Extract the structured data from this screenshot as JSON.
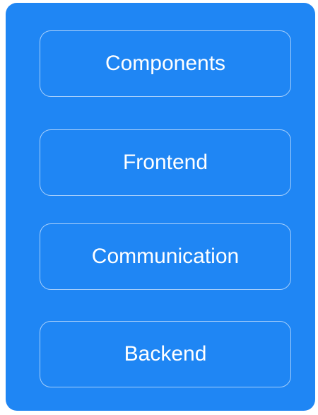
{
  "diagram": {
    "background_color": "#1f86f4",
    "text_color": "#ffffff",
    "items": [
      {
        "label": "Components"
      },
      {
        "label": "Frontend"
      },
      {
        "label": "Communication"
      },
      {
        "label": "Backend"
      }
    ]
  }
}
